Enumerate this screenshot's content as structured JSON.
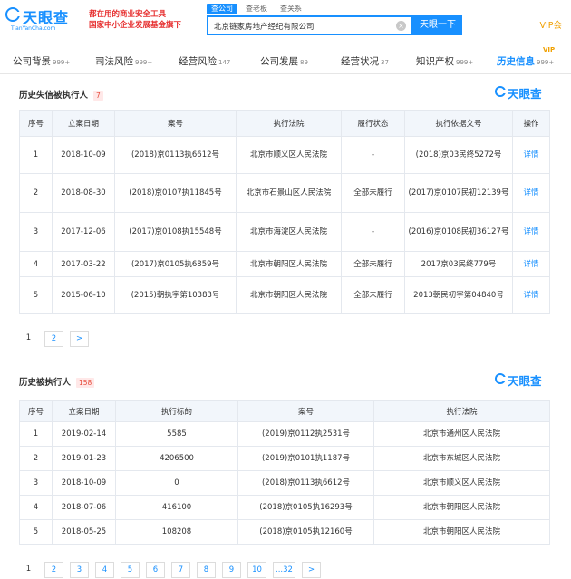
{
  "header": {
    "logo_text": "天眼查",
    "logo_sub": "TianYanCha.com",
    "slogan_line1": "都在用的商业安全工具",
    "slogan_line2": "国家中小企业发展基金旗下",
    "search_tabs": [
      "查公司",
      "查老板",
      "查关系"
    ],
    "search_value": "北京链家房地产经纪有限公司",
    "search_button": "天眼一下",
    "vip_link": "VIP会"
  },
  "nav": {
    "items": [
      {
        "label": "公司背景",
        "count": "999+"
      },
      {
        "label": "司法风险",
        "count": "999+"
      },
      {
        "label": "经营风险",
        "count": "147"
      },
      {
        "label": "公司发展",
        "count": "89"
      },
      {
        "label": "经营状况",
        "count": "37"
      },
      {
        "label": "知识产权",
        "count": "999+"
      },
      {
        "label": "历史信息",
        "count": "999+"
      }
    ],
    "vip_badge": "VIP"
  },
  "watermark_text": "天眼查",
  "section1": {
    "title": "历史失信被执行人",
    "count": "7",
    "headers": [
      "序号",
      "立案日期",
      "案号",
      "执行法院",
      "履行状态",
      "执行依据文号",
      "操作"
    ],
    "rows": [
      [
        "1",
        "2018-10-09",
        "(2018)京0113执6612号",
        "北京市顺义区人民法院",
        "-",
        "(2018)京03民终5272号",
        "详情"
      ],
      [
        "2",
        "2018-08-30",
        "(2018)京0107执11845号",
        "北京市石景山区人民法院",
        "全部未履行",
        "(2017)京0107民初12139号",
        "详情"
      ],
      [
        "3",
        "2017-12-06",
        "(2017)京0108执15548号",
        "北京市海淀区人民法院",
        "-",
        "(2016)京0108民初36127号",
        "详情"
      ],
      [
        "4",
        "2017-03-22",
        "(2017)京0105执6859号",
        "北京市朝阳区人民法院",
        "全部未履行",
        "2017京03民终779号",
        "详情"
      ],
      [
        "5",
        "2015-06-10",
        "(2015)朝执字第10383号",
        "北京市朝阳区人民法院",
        "全部未履行",
        "2013朝民初字第04840号",
        "详情"
      ]
    ],
    "pager": [
      "1",
      "2",
      ">"
    ]
  },
  "section2": {
    "title": "历史被执行人",
    "count": "158",
    "headers": [
      "序号",
      "立案日期",
      "执行标的",
      "案号",
      "执行法院"
    ],
    "rows": [
      [
        "1",
        "2019-02-14",
        "5585",
        "(2019)京0112执2531号",
        "北京市通州区人民法院"
      ],
      [
        "2",
        "2019-01-23",
        "4206500",
        "(2019)京0101执1187号",
        "北京市东城区人民法院"
      ],
      [
        "3",
        "2018-10-09",
        "0",
        "(2018)京0113执6612号",
        "北京市顺义区人民法院"
      ],
      [
        "4",
        "2018-07-06",
        "416100",
        "(2018)京0105执16293号",
        "北京市朝阳区人民法院"
      ],
      [
        "5",
        "2018-05-25",
        "108208",
        "(2018)京0105执12160号",
        "北京市朝阳区人民法院"
      ]
    ],
    "pager": [
      "1",
      "2",
      "3",
      "4",
      "5",
      "6",
      "7",
      "8",
      "9",
      "10",
      "...32",
      ">"
    ]
  }
}
